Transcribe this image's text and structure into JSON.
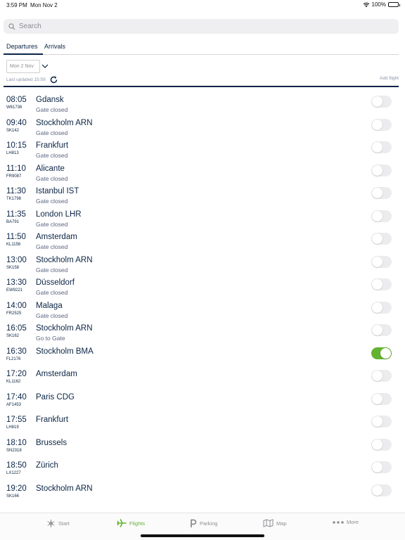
{
  "status_bar": {
    "time": "3:59 PM",
    "date": "Mon Nov 2",
    "battery": "100%",
    "battery_level": 1.0
  },
  "search": {
    "placeholder": "Search"
  },
  "tabs": [
    {
      "label": "Departures",
      "selected": true
    },
    {
      "label": "Arrivals",
      "selected": false
    }
  ],
  "date_select": {
    "value": "Mon 2 Nov"
  },
  "last_updated": "Last updated 15:59",
  "add_flight_label": "Add flight",
  "colors": {
    "accent": "#63b331",
    "text": "#0b2545"
  },
  "flights": [
    {
      "time": "08:05",
      "flight": "W61736",
      "destination": "Gdansk",
      "status": "Gate closed",
      "following": false
    },
    {
      "time": "09:40",
      "flight": "SK142",
      "destination": "Stockholm ARN",
      "status": "Gate closed",
      "following": false
    },
    {
      "time": "10:15",
      "flight": "LH813",
      "destination": "Frankfurt",
      "status": "Gate closed",
      "following": false
    },
    {
      "time": "11:10",
      "flight": "FR9087",
      "destination": "Alicante",
      "status": "Gate closed",
      "following": false
    },
    {
      "time": "11:30",
      "flight": "TK1798",
      "destination": "Istanbul IST",
      "status": "Gate closed",
      "following": false
    },
    {
      "time": "11:35",
      "flight": "BA791",
      "destination": "London LHR",
      "status": "Gate closed",
      "following": false
    },
    {
      "time": "11:50",
      "flight": "KL1156",
      "destination": "Amsterdam",
      "status": "Gate closed",
      "following": false
    },
    {
      "time": "13:00",
      "flight": "SK158",
      "destination": "Stockholm ARN",
      "status": "Gate closed",
      "following": false
    },
    {
      "time": "13:30",
      "flight": "EW9221",
      "destination": "Düsseldorf",
      "status": "Gate closed",
      "following": false
    },
    {
      "time": "14:00",
      "flight": "FR2525",
      "destination": "Malaga",
      "status": "Gate closed",
      "following": false
    },
    {
      "time": "16:05",
      "flight": "SK162",
      "destination": "Stockholm ARN",
      "status": "Go to Gate",
      "following": false
    },
    {
      "time": "16:30",
      "flight": "FL2176",
      "destination": "Stockholm BMA",
      "status": "",
      "following": true
    },
    {
      "time": "17:20",
      "flight": "KL1162",
      "destination": "Amsterdam",
      "status": "",
      "following": false
    },
    {
      "time": "17:40",
      "flight": "AF1453",
      "destination": "Paris CDG",
      "status": "",
      "following": false
    },
    {
      "time": "17:55",
      "flight": "LH819",
      "destination": "Frankfurt",
      "status": "",
      "following": false
    },
    {
      "time": "18:10",
      "flight": "SN2318",
      "destination": "Brussels",
      "status": "",
      "following": false
    },
    {
      "time": "18:50",
      "flight": "LX1227",
      "destination": "Zürich",
      "status": "",
      "following": false
    },
    {
      "time": "19:20",
      "flight": "SK166",
      "destination": "Stockholm ARN",
      "status": "",
      "following": false
    }
  ],
  "tabbar": [
    {
      "label": "Start",
      "icon": "snowflake-icon",
      "active": false
    },
    {
      "label": "Flights",
      "icon": "airplane-icon",
      "active": true
    },
    {
      "label": "Parking",
      "icon": "parking-icon",
      "active": false
    },
    {
      "label": "Map",
      "icon": "map-icon",
      "active": false
    },
    {
      "label": "More",
      "icon": "more-dots-icon",
      "active": false
    }
  ]
}
